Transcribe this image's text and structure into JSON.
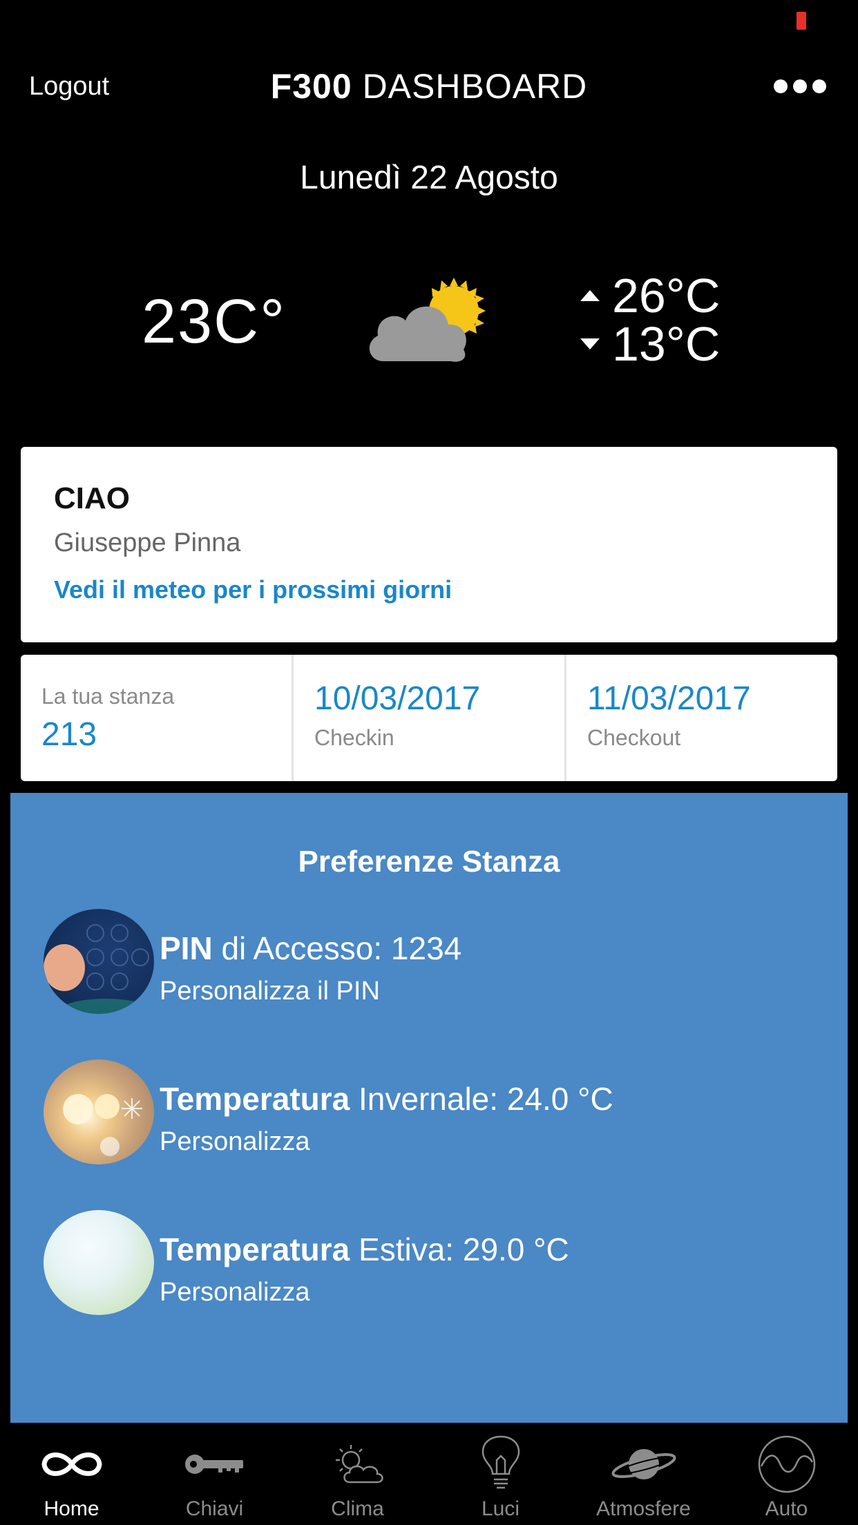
{
  "header": {
    "logout_label": "Logout",
    "title_bold": "F300",
    "title_light": " DASHBOARD",
    "menu_icon": "more-dots-icon"
  },
  "date": "Lunedì 22 Agosto",
  "weather": {
    "current_temp": "23C°",
    "condition_icon": "partly-cloudy-icon",
    "max_temp": "26°C",
    "min_temp": "13°C"
  },
  "greeting": {
    "hello": "CIAO",
    "guest_name": "Giuseppe Pinna",
    "forecast_link": "Vedi il meteo per i prossimi giorni"
  },
  "stay": {
    "room_label": "La tua stanza",
    "room_number": "213",
    "checkin_date": "10/03/2017",
    "checkin_label": "Checkin",
    "checkout_date": "11/03/2017",
    "checkout_label": "Checkout"
  },
  "preferences": {
    "title": "Preferenze Stanza",
    "items": [
      {
        "bold": "PIN",
        "rest": " di Accesso: 1234",
        "action": "Personalizza il PIN"
      },
      {
        "bold": "Temperatura",
        "rest": " Invernale: 24.0 °C",
        "action": "Personalizza"
      },
      {
        "bold": "Temperatura",
        "rest": " Estiva: 29.0 °C",
        "action": "Personalizza"
      }
    ]
  },
  "tabs": [
    {
      "label": "Home",
      "icon": "infinity-icon",
      "active": true
    },
    {
      "label": "Chiavi",
      "icon": "key-icon",
      "active": false
    },
    {
      "label": "Clima",
      "icon": "sun-cloud-icon",
      "active": false
    },
    {
      "label": "Luci",
      "icon": "lightbulb-icon",
      "active": false
    },
    {
      "label": "Atmosfere",
      "icon": "planet-icon",
      "active": false
    },
    {
      "label": "Auto",
      "icon": "wave-circle-icon",
      "active": false
    }
  ],
  "colors": {
    "accent_blue": "#1a87c7",
    "preferences_bg": "#4a88c6",
    "battery_red": "#e8302a"
  }
}
